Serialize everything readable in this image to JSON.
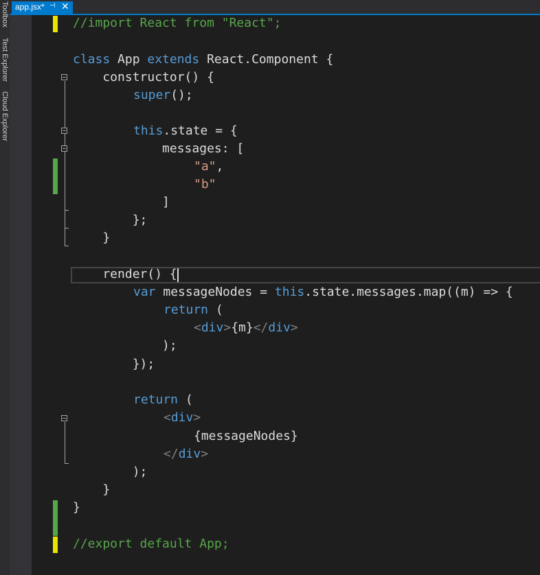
{
  "window": {
    "side_tabs": [
      "Toolbox",
      "Test Explorer",
      "Cloud Explorer"
    ]
  },
  "editor_tab": {
    "title": "app.jsx*",
    "pin_glyph": "⊣",
    "close_glyph": "✕"
  },
  "code_lines": {
    "l1": "//import React from \"React\";",
    "l3_class": "class",
    "l3_name": " App ",
    "l3_extends": "extends",
    "l3_rest": " React.Component {",
    "l4": "    constructor() {",
    "l5_super": "super",
    "l5_rest": "();",
    "l7_this": "this",
    "l7_rest": ".state = {",
    "l8": "            messages: [",
    "l9": "\"a\"",
    "l9_comma": ",",
    "l10": "\"b\"",
    "l11": "            ]",
    "l12": "        };",
    "l13": "    }",
    "l15": "    render() {",
    "l16_var": "var",
    "l16_mid": " messageNodes = ",
    "l16_this": "this",
    "l16_rest": ".state.messages.map((m) => {",
    "l17_return": "return",
    "l17_rest": " (",
    "l18_lt1": "<",
    "l18_div1": "div",
    "l18_gt1": ">",
    "l18_m": "{m}",
    "l18_lt2": "</",
    "l18_div2": "div",
    "l18_gt2": ">",
    "l19": "            );",
    "l20": "        });",
    "l22_return": "return",
    "l22_rest": " (",
    "l23_lt": "<",
    "l23_div": "div",
    "l23_gt": ">",
    "l24": "{messageNodes}",
    "l25_lt": "</",
    "l25_div": "div",
    "l25_gt": ">",
    "l26": "        );",
    "l27": "    }",
    "l28": "}",
    "l30": "//export default App;"
  },
  "colors": {
    "keyword": "#569cd6",
    "string": "#d69d85",
    "comment": "#57a64a",
    "text": "#dcdcdc",
    "unsaved_change": "#e5e500",
    "saved_change": "#57a64a"
  }
}
